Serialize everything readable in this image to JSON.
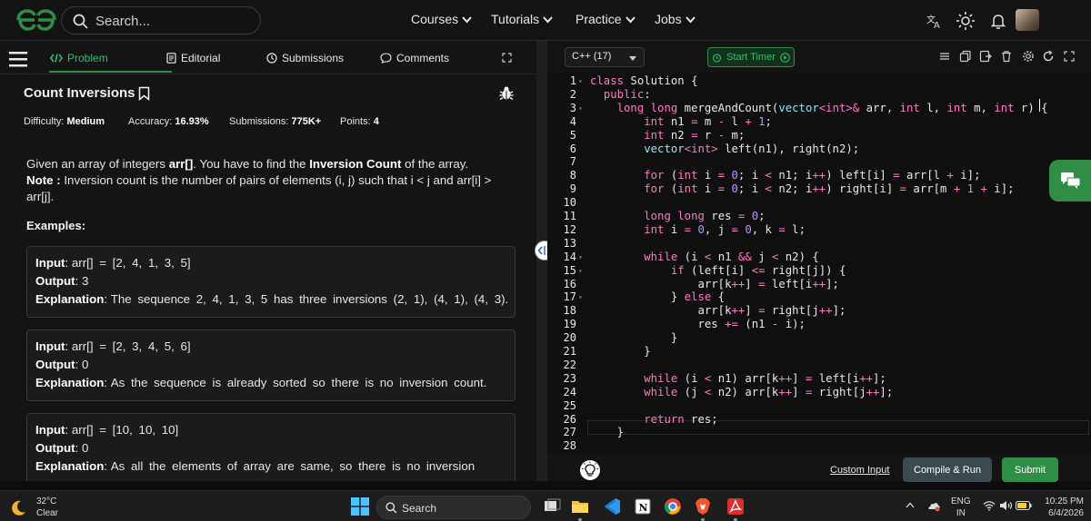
{
  "nav": {
    "search_placeholder": "Search...",
    "links": [
      {
        "label": "Courses"
      },
      {
        "label": "Tutorials"
      },
      {
        "label": "Practice"
      },
      {
        "label": "Jobs"
      }
    ],
    "brand_color": "#2f8d46"
  },
  "problem_panel": {
    "tabs": [
      {
        "label": "Problem",
        "active": true
      },
      {
        "label": "Editorial"
      },
      {
        "label": "Submissions"
      },
      {
        "label": "Comments"
      }
    ],
    "title": "Count Inversions",
    "meta": {
      "difficulty_label": "Difficulty:",
      "difficulty": "Medium",
      "accuracy_label": "Accuracy:",
      "accuracy": "16.93%",
      "submissions_label": "Submissions:",
      "submissions": "775K+",
      "points_label": "Points:",
      "points": "4"
    },
    "description": {
      "p1_a": "Given an array of integers ",
      "p1_b": "arr[]",
      "p1_c": ". You have to find the ",
      "p1_d": "Inversion Count",
      "p1_e": " of the array.",
      "note_label": "Note :",
      "note_a": " Inversion count is the number of pairs of elements (i, j) such that i < j and arr[i] >",
      "note_b": "arr[j]."
    },
    "examples_heading": "Examples:",
    "examples": [
      {
        "input_label": "Input",
        "input": "arr[] = [2, 4, 1, 3, 5]",
        "output_label": "Output",
        "output": "3",
        "explanation_label": "Explanation",
        "explanation": "The sequence 2, 4, 1, 3, 5 has three inversions (2, 1), (4, 1), (4, 3)."
      },
      {
        "input_label": "Input",
        "input": "arr[] = [2, 3, 4, 5, 6]",
        "output_label": "Output",
        "output": "0",
        "explanation_label": "Explanation",
        "explanation": "As the sequence is already sorted so there is no inversion count."
      },
      {
        "input_label": "Input",
        "input": "arr[] = [10, 10, 10]",
        "output_label": "Output",
        "output": "0",
        "explanation_label": "Explanation",
        "explanation": "As all the elements of array are same, so there is no inversion"
      }
    ]
  },
  "editor": {
    "language": "C++ (17)",
    "timer_label": "Start Timer",
    "line_numbers": [
      "1",
      "2",
      "3",
      "4",
      "5",
      "6",
      "7",
      "8",
      "9",
      "10",
      "11",
      "12",
      "13",
      "14",
      "15",
      "16",
      "17",
      "18",
      "19",
      "20",
      "21",
      "22",
      "23",
      "24",
      "25",
      "26",
      "27",
      "28"
    ],
    "code": [
      "class Solution {",
      "  public:",
      "    long long mergeAndCount(vector<int>& arr, int l, int m, int r) {",
      "        int n1 = m - l + 1;",
      "        int n2 = r - m;",
      "        vector<int> left(n1), right(n2);",
      "",
      "        for (int i = 0; i < n1; i++) left[i] = arr[l + i];",
      "        for (int i = 0; i < n2; i++) right[i] = arr[m + 1 + i];",
      "",
      "        long long res = 0;",
      "        int i = 0, j = 0, k = l;",
      "",
      "        while (i < n1 && j < n2) {",
      "            if (left[i] <= right[j]) {",
      "                arr[k++] = left[i++];",
      "            } else {",
      "                arr[k++] = right[j++];",
      "                res += (n1 - i);",
      "            }",
      "        }",
      "",
      "        while (i < n1) arr[k++] = left[i++];",
      "        while (j < n2) arr[k++] = right[j++];",
      "",
      "        return res;",
      "    }",
      ""
    ],
    "custom_input_label": "Custom Input",
    "compile_label": "Compile & Run",
    "submit_label": "Submit"
  },
  "taskbar": {
    "weather_temp": "32°C",
    "weather_cond": "Clear",
    "search_label": "Search",
    "lang_top": "ENG",
    "lang_bottom": "IN",
    "time": "10:25 PM",
    "date": "6/4/2026"
  }
}
